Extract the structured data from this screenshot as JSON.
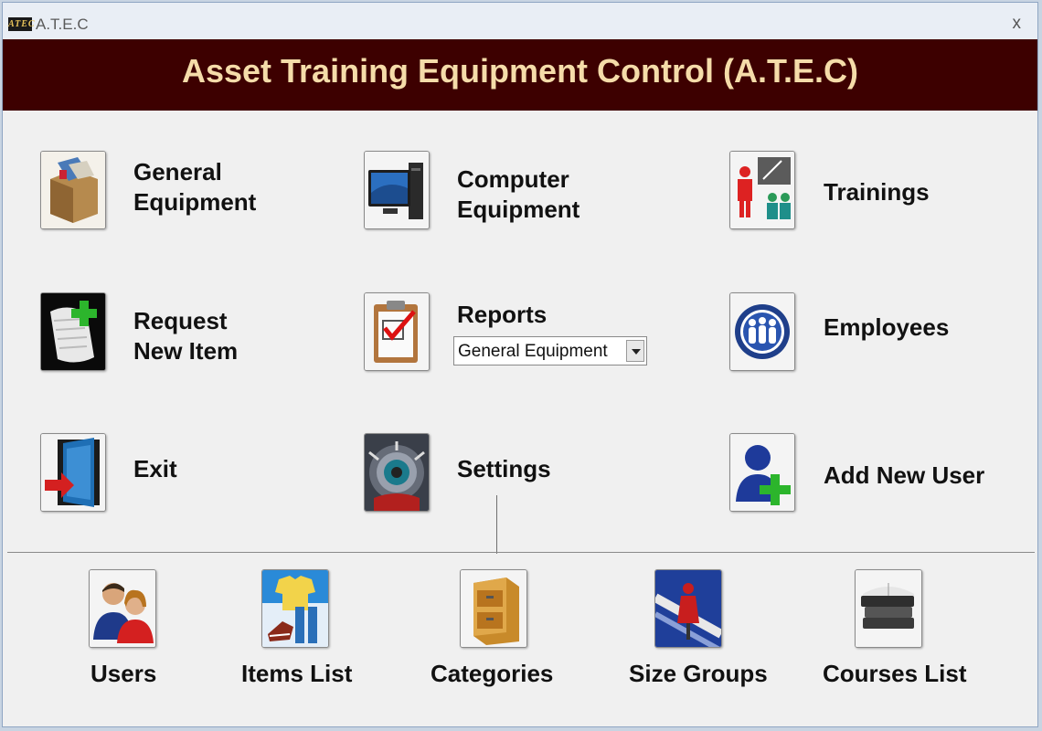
{
  "window": {
    "app_icon_text": "ATEC",
    "title": "A.T.E.C",
    "close_glyph": "x"
  },
  "banner": {
    "title": "Asset Training Equipment Control (A.T.E.C)",
    "background_color": "#3d0000",
    "text_color": "#f5dca9"
  },
  "tiles": {
    "general_equipment": {
      "line1": "General",
      "line2": "Equipment",
      "icon": "box-icon"
    },
    "computer_equipment": {
      "line1": "Computer",
      "line2": "Equipment",
      "icon": "computer-icon"
    },
    "trainings": {
      "label": "Trainings",
      "icon": "training-icon"
    },
    "request_new_item": {
      "line1": "Request",
      "line2": "New Item",
      "icon": "document-add-icon"
    },
    "reports": {
      "label": "Reports",
      "icon": "clipboard-check-icon",
      "selected_report": "General Equipment"
    },
    "employees": {
      "label": "Employees",
      "icon": "employees-icon"
    },
    "exit": {
      "label": "Exit",
      "icon": "exit-door-icon"
    },
    "settings": {
      "label": "Settings",
      "icon": "settings-gear-icon"
    },
    "add_new_user": {
      "label": "Add New User",
      "icon": "add-user-icon"
    }
  },
  "settings_menu": [
    {
      "label": "Users",
      "icon": "users-icon"
    },
    {
      "label": "Items List",
      "icon": "items-list-icon"
    },
    {
      "label": "Categories",
      "icon": "filing-cabinet-icon"
    },
    {
      "label": "Size Groups",
      "icon": "size-groups-icon"
    },
    {
      "label": "Courses List",
      "icon": "books-icon"
    }
  ]
}
